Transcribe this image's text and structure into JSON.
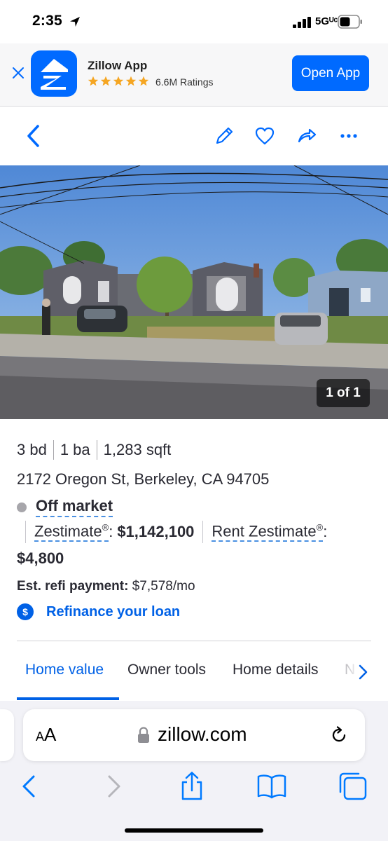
{
  "status_bar": {
    "time": "2:35",
    "network": "5Gᵁᶜ",
    "icons": [
      "location-arrow-icon",
      "signal-bars-icon",
      "battery-icon"
    ]
  },
  "app_banner": {
    "app_name": "Zillow App",
    "ratings": "6.6M Ratings",
    "star_count": 5,
    "open_button": "Open App",
    "colors": {
      "brand": "#006aff",
      "star": "#f5a623"
    }
  },
  "nav_bar": {
    "icons": [
      "back-chevron-icon",
      "edit-pencil-icon",
      "heart-icon",
      "share-icon",
      "more-icon"
    ]
  },
  "photo": {
    "counter": "1 of 1"
  },
  "summary": {
    "beds": "3 bd",
    "baths": "1 ba",
    "sqft": "1,283 sqft",
    "address": "2172 Oregon St, Berkeley, CA 94705",
    "market_status": "Off market",
    "zestimate_label": "Zestimate",
    "registered_mark": "®",
    "zestimate_suffix": ":",
    "zestimate_value": "$1,142,100",
    "rent_zestimate_label": "Rent Zestimate",
    "rent_zestimate_suffix": ":",
    "rent_zestimate_value": "$4,800",
    "refi_label": "Est. refi payment:",
    "refi_value": "$7,578/mo",
    "refi_link": "Refinance your loan",
    "refi_link_icon_glyph": "$"
  },
  "tabs": {
    "items": [
      {
        "label": "Home value",
        "active": true
      },
      {
        "label": "Owner tools",
        "active": false
      },
      {
        "label": "Home details",
        "active": false
      },
      {
        "label": "N",
        "active": false
      }
    ],
    "accent": "#0061e6"
  },
  "browser": {
    "text_size_label_small": "A",
    "text_size_label_large": "A",
    "url": "zillow.com",
    "toolbar": [
      "back-icon",
      "forward-icon",
      "share-icon",
      "bookmarks-icon",
      "tabs-icon"
    ],
    "accent": "#007aff"
  }
}
